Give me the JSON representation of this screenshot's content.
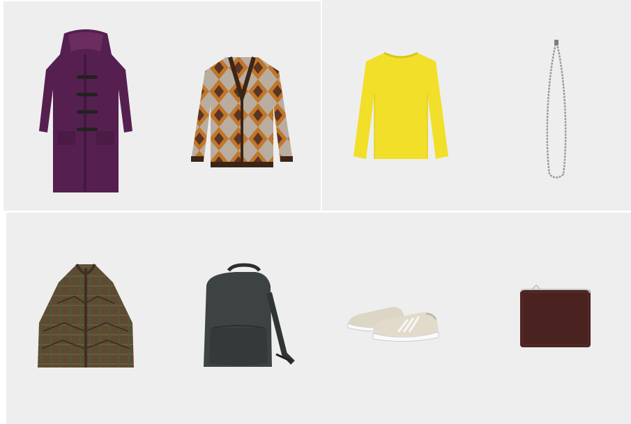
{
  "products": [
    {
      "name": "duffle-coat",
      "color": "#5a1f4e"
    },
    {
      "name": "argyle-cardigan",
      "color": "#c2762a"
    },
    {
      "name": "crewneck-sweater",
      "color": "#f1df2a"
    },
    {
      "name": "chain-necklace",
      "color": "#9a9a9a"
    },
    {
      "name": "check-down-poncho",
      "color": "#5e4a32"
    },
    {
      "name": "backpack",
      "color": "#3c4342"
    },
    {
      "name": "suede-sneakers",
      "color": "#ddd6c6"
    },
    {
      "name": "leather-wallet",
      "color": "#4a2320"
    }
  ]
}
